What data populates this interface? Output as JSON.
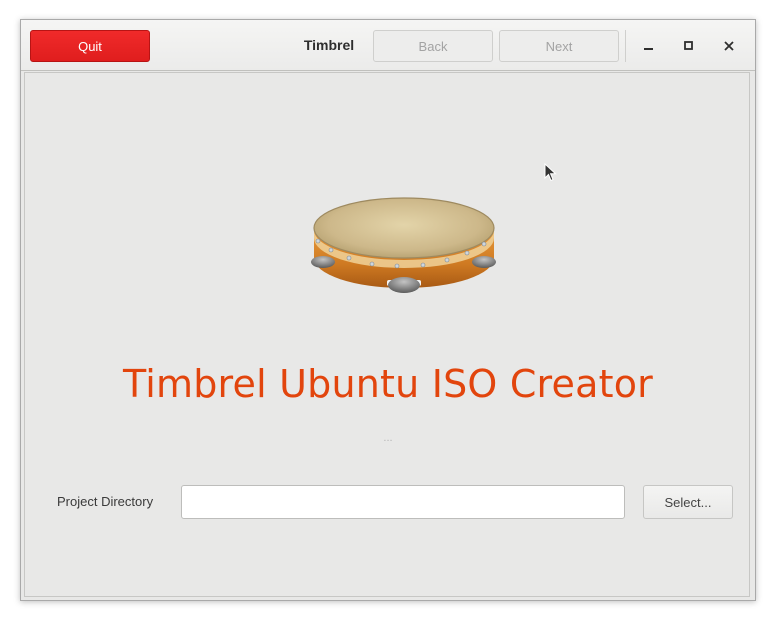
{
  "headerbar": {
    "quit_label": "Quit",
    "title": "Timbrel",
    "back_label": "Back",
    "next_label": "Next",
    "window_controls": [
      "minimize-icon",
      "maximize-icon",
      "close-icon"
    ]
  },
  "main": {
    "logo_icon": "tambourine-icon",
    "app_title": "Timbrel Ubuntu ISO Creator",
    "status_text": "...",
    "project_directory": {
      "label": "Project Directory",
      "value": "",
      "select_label": "Select..."
    }
  },
  "colors": {
    "accent": "#e2450d",
    "quit_button": "#e82222",
    "window_bg": "#e8e8e7"
  }
}
